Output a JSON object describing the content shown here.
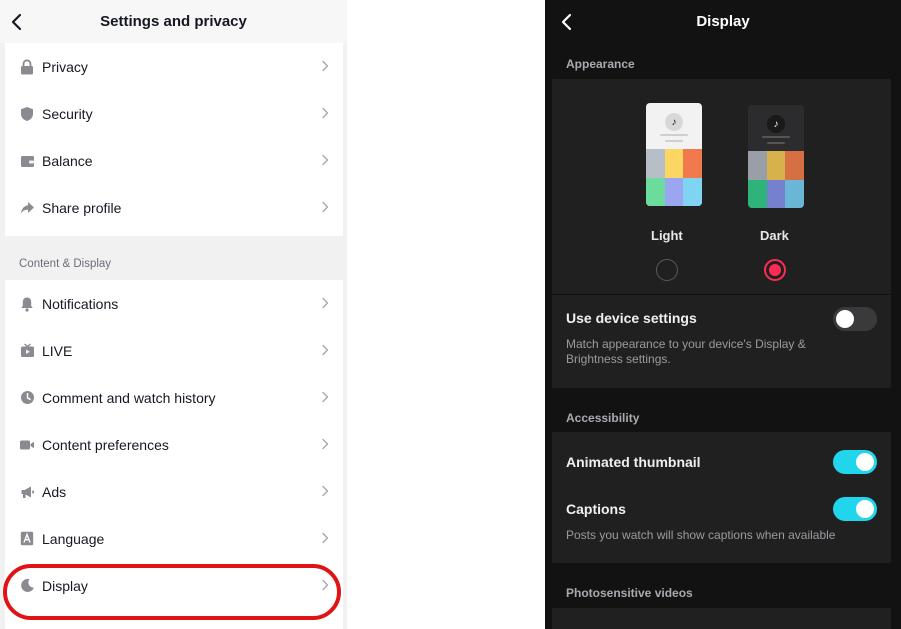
{
  "left": {
    "title": "Settings and privacy",
    "account_items": [
      {
        "label": "Privacy",
        "icon": "lock-icon"
      },
      {
        "label": "Security",
        "icon": "shield-icon"
      },
      {
        "label": "Balance",
        "icon": "wallet-icon"
      },
      {
        "label": "Share profile",
        "icon": "share-icon"
      }
    ],
    "section_label": "Content & Display",
    "display_items": [
      {
        "label": "Notifications",
        "icon": "bell-icon"
      },
      {
        "label": "LIVE",
        "icon": "live-tv-icon"
      },
      {
        "label": "Comment and watch history",
        "icon": "clock-icon"
      },
      {
        "label": "Content preferences",
        "icon": "video-camera-icon"
      },
      {
        "label": "Ads",
        "icon": "megaphone-icon"
      },
      {
        "label": "Language",
        "icon": "language-icon"
      },
      {
        "label": "Display",
        "icon": "moon-icon"
      }
    ]
  },
  "right": {
    "title": "Display",
    "appearance": {
      "section_label": "Appearance",
      "light_label": "Light",
      "dark_label": "Dark",
      "selected": "Dark",
      "use_device_title": "Use device settings",
      "use_device_desc": "Match appearance to your device's Display & Brightness settings.",
      "use_device_on": false
    },
    "accessibility": {
      "section_label": "Accessibility",
      "animated_title": "Animated thumbnail",
      "animated_on": true,
      "captions_title": "Captions",
      "captions_on": true,
      "captions_desc": "Posts you watch will show captions when available"
    },
    "photosensitive": {
      "section_label": "Photosensitive videos"
    }
  },
  "colors": {
    "accent_red": "#fe2c55",
    "toggle_on": "#20d5ec",
    "highlight": "#e01414",
    "light_grid": [
      "#b7bec8",
      "#fbd662",
      "#f07a4d",
      "#6bdc9c",
      "#9aa6f0",
      "#7ed4f2"
    ],
    "dark_grid": [
      "#9a9ea6",
      "#d7b24c",
      "#d66f44",
      "#2eb37a",
      "#7580cf",
      "#69b6d6"
    ]
  }
}
